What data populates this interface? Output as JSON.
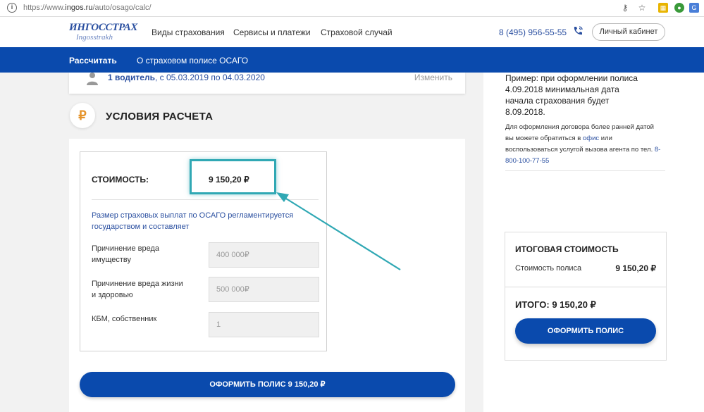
{
  "browser": {
    "url_prefix": "https://www.",
    "url_host": "ingos.ru",
    "url_path": "/auto/osago/calc/"
  },
  "header": {
    "logo_main": "ИНГОССТРАХ",
    "logo_sub": "Ingosstrakh",
    "nav": [
      "Виды страхования",
      "Сервисы и платежи",
      "Страховой случай"
    ],
    "phone": "8 (495) 956-55-55",
    "cabinet_label": "Личный кабинет"
  },
  "subnav": {
    "items": [
      "Рассчитать",
      "О страховом полисе ОСАГО"
    ]
  },
  "driver": {
    "drivers": "1 водитель",
    "period": ", с 05.03.2019 по 04.03.2020",
    "change_label": "Изменить"
  },
  "section": {
    "icon": "₽",
    "title": "УСЛОВИЯ РАСЧЕТА"
  },
  "calc": {
    "cost_label": "СТОИМОСТЬ:",
    "cost_value": "9 150,20 ₽",
    "info": "Размер страховых выплат по ОСАГО регламентируется государством и составляет",
    "rows": [
      {
        "label": "Причинение вреда имуществу",
        "value": "400 000₽"
      },
      {
        "label": "Причинение вреда жизни и здоровью",
        "value": "500 000₽"
      },
      {
        "label": "КБМ, собственник",
        "value": "1"
      }
    ],
    "button_label": "ОФОРМИТЬ ПОЛИС 9 150,20 ₽"
  },
  "aside": {
    "example": "Пример: при оформлении полиса 4.09.2018 минимальная дата начала страхования будет 8.09.2018.",
    "note_pre": "Для оформления договора более ранней датой вы можете обратиться в ",
    "note_link1": "офис",
    "note_mid": " или воспользоваться услугой вызова агента по тел. ",
    "note_link2": "8-800-100-77-55"
  },
  "total": {
    "title": "ИТОГОВАЯ СТОИМОСТЬ",
    "row_label": "Стоимость полиса",
    "row_value": "9 150,20 ₽",
    "sum": "ИТОГО: 9 150,20 ₽",
    "button_label": "ОФОРМИТЬ ПОЛИС"
  },
  "colors": {
    "brand_blue": "#0a4aad",
    "link_blue": "#2a4fa0",
    "highlight_teal": "#30a8b4",
    "ruble_orange": "#e5932a"
  }
}
